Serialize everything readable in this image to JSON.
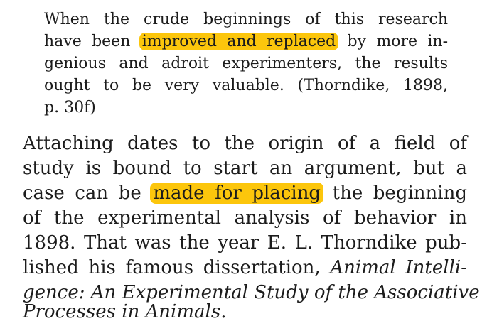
{
  "quote": {
    "lines": [
      [
        "When the crude beginnings of this research"
      ],
      [
        "have been ",
        "improved and replaced",
        " by more in-"
      ],
      [
        "genious and adroit experimenters, the results"
      ],
      [
        "ought to be very valuable. (Thorndike, 1898,"
      ],
      [
        "p. 30f)"
      ]
    ]
  },
  "paragraph": {
    "lines": [
      [
        "Attaching dates to the origin of a field of"
      ],
      [
        "study is bound to start an argument, but a"
      ],
      [
        "case can be ",
        "made for placing",
        " the beginning"
      ],
      [
        "of the experimental analysis of behavior in"
      ],
      [
        "1898. That was the year E. L. Thorndike pub-"
      ],
      [
        "lished his famous dissertation, ",
        "Animal Intelli-"
      ],
      [
        "gence: An Experimental Study of the Associative"
      ],
      [
        "Processes in Animals",
        "."
      ]
    ]
  },
  "colors": {
    "highlight": "#fcc60c",
    "text": "#1c1c1c"
  }
}
